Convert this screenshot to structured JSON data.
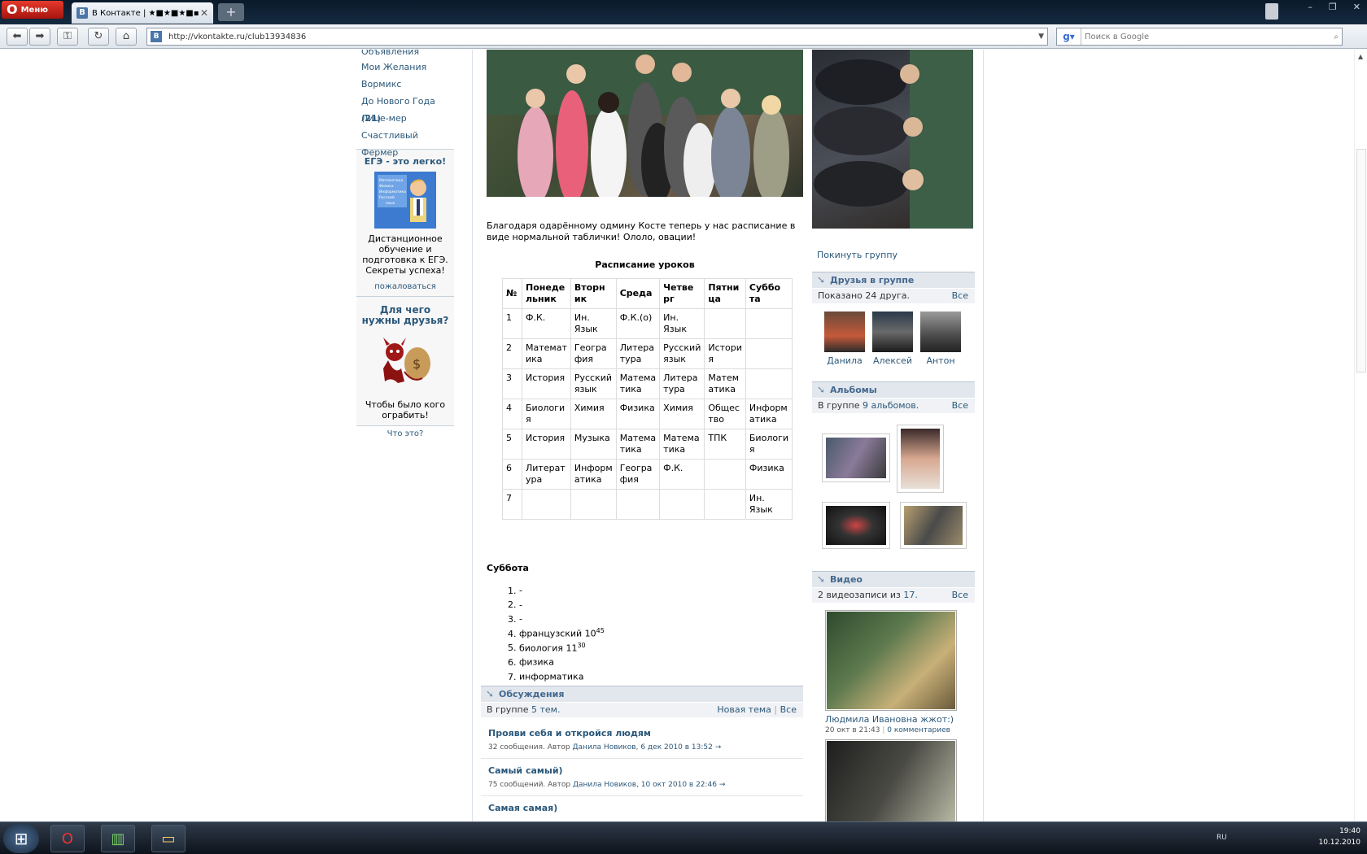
{
  "browser": {
    "menu_label": "Меню",
    "tab_title": "В Контакте | ★■★■★■▪",
    "url": "http://vkontakte.ru/club13934836",
    "search_placeholder": "Поиск в Google"
  },
  "left_menu": {
    "items": [
      "Объявления",
      "Мои Желания",
      "Вормикс",
      "До Нового Года",
      "Лице-мер",
      "Счастливый Фермер"
    ],
    "new_year_count": "21"
  },
  "ad1": {
    "title": "ЕГЭ - это легко!",
    "image_lines": [
      "Математика",
      "Физика",
      "Информатика",
      "Русский",
      "язык"
    ],
    "text": "Дистанционное обучение и подготовка к ЕГЭ. Секреты успеха!",
    "complain": "пожаловаться"
  },
  "ad2": {
    "title": "Для чего нужны друзья?",
    "text": "Чтобы было кого ограбить!",
    "what": "Что это?"
  },
  "wall": {
    "intro": "Благодаря одарённому одмину Косте теперь у нас расписание в виде нормальной таблички! Ололо, овации!",
    "table_title": "Расписание уроков",
    "headers": [
      "№",
      "Понеде льник",
      "Вторн ик",
      "Среда",
      "Четве рг",
      "Пятни ца",
      "Суббо та"
    ],
    "rows": [
      [
        "1",
        "Ф.К.",
        "Ин. Язык",
        "Ф.К.(о)",
        "Ин. Язык",
        "",
        ""
      ],
      [
        "2",
        "Математ ика",
        "Геогра фия",
        "Литера тура",
        "Русский язык",
        "Истори я",
        ""
      ],
      [
        "3",
        "История",
        "Русский язык",
        "Матема тика",
        "Литера тура",
        "Матем атика",
        ""
      ],
      [
        "4",
        "Биологи я",
        "Химия",
        "Физика",
        "Химия",
        "Общес тво",
        "Информ атика"
      ],
      [
        "5",
        "История",
        "Музыка",
        "Матема тика",
        "Матема тика",
        "ТПК",
        "Биологи я"
      ],
      [
        "6",
        "Литерат ура",
        "Информ атика",
        "Геогра фия",
        "Ф.К.",
        "",
        "Физика"
      ],
      [
        "7",
        "",
        "",
        "",
        "",
        "",
        "Ин. Язык"
      ]
    ],
    "saturday_title": "Суббота",
    "saturday": [
      {
        "text": "-",
        "sup": ""
      },
      {
        "text": "-",
        "sup": ""
      },
      {
        "text": "-",
        "sup": ""
      },
      {
        "text": "французский 10",
        "sup": "45"
      },
      {
        "text": "биология 11",
        "sup": "30"
      },
      {
        "text": "физика",
        "sup": ""
      },
      {
        "text": "информатика",
        "sup": ""
      }
    ]
  },
  "discussions": {
    "title": "Обсуждения",
    "count_prefix": "В группе",
    "count_link": "5 тем.",
    "new_topic": "Новая тема",
    "all": "Все",
    "topics": [
      {
        "title": "Прояви себя и откройся людям",
        "count": "32 сообщения. Автор",
        "author": "Данила Новиков",
        "date": "6 дек 2010 в 13:52",
        "arrow": "→"
      },
      {
        "title": "Самый самый)",
        "count": "75 сообщений. Автор",
        "author": "Данила Новиков",
        "date": "10 окт 2010 в 22:46",
        "arrow": "→"
      },
      {
        "title": "Самая самая)",
        "count": "",
        "author": "",
        "date": "",
        "arrow": ""
      }
    ]
  },
  "sidebar": {
    "leave_group": "Покинуть группу",
    "friends_title": "Друзья в группе",
    "friends_shown": "Показано 24 друга.",
    "all": "Все",
    "friends": [
      "Данила",
      "Алексей",
      "Антон"
    ],
    "albums_title": "Альбомы",
    "albums_prefix": "В группе",
    "albums_count": "9 альбомов.",
    "video_title": "Видео",
    "video_prefix": "2 видеозаписи из",
    "video_count": "17.",
    "video_caption": "Людмила Ивановна жжот:)",
    "video_date": "20 окт в 21:43",
    "video_comments": "0 комментариев",
    "separator": "|"
  },
  "taskbar": {
    "lang": "RU",
    "time": "19:40",
    "date": "10.12.2010"
  },
  "colors": {
    "link": "#2b587a",
    "header_bg": "#e1e7ed",
    "header_text": "#45688e"
  }
}
